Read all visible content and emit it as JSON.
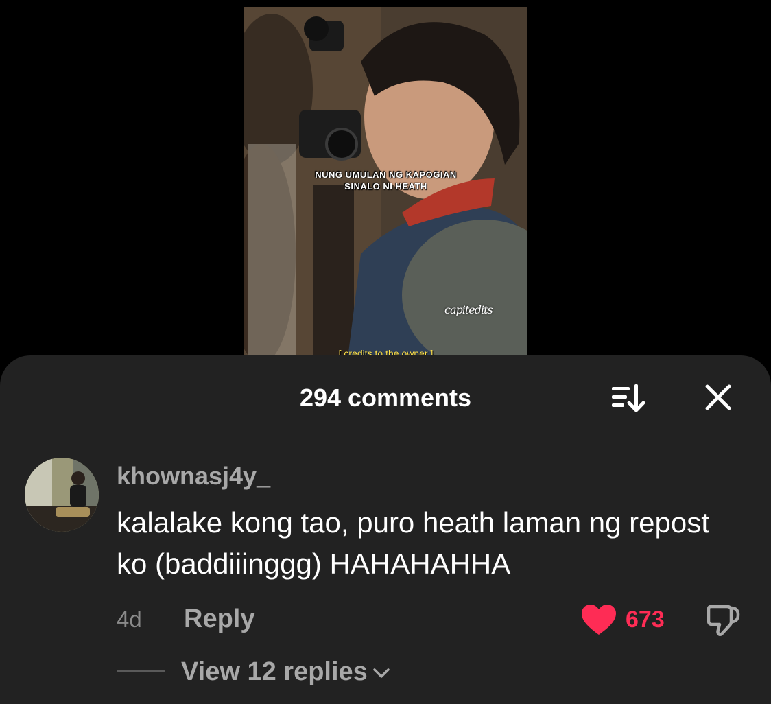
{
  "video": {
    "caption_line1": "NUNG UMULAN NG KAPOGIAN",
    "caption_line2": "SINALO NI HEATH",
    "watermark": "capitedits",
    "credits": "[ credits to the owner ]"
  },
  "comments_sheet": {
    "title": "294 comments",
    "sort_icon": "sort-icon",
    "close_icon": "close-icon"
  },
  "comment": {
    "username": "khownasj4y_",
    "text": "kalalake kong tao, puro heath laman ng repost ko (baddiiinggg) HAHAHAHHA",
    "time": "4d",
    "reply_label": "Reply",
    "like_count": "673",
    "liked": true,
    "like_icon": "heart-filled-icon",
    "dislike_icon": "thumbs-down-icon",
    "view_replies_label": "View 12 replies"
  },
  "colors": {
    "sheet_bg": "#222222",
    "like_red": "#fe2c55",
    "secondary_text": "#a8a8a8"
  }
}
